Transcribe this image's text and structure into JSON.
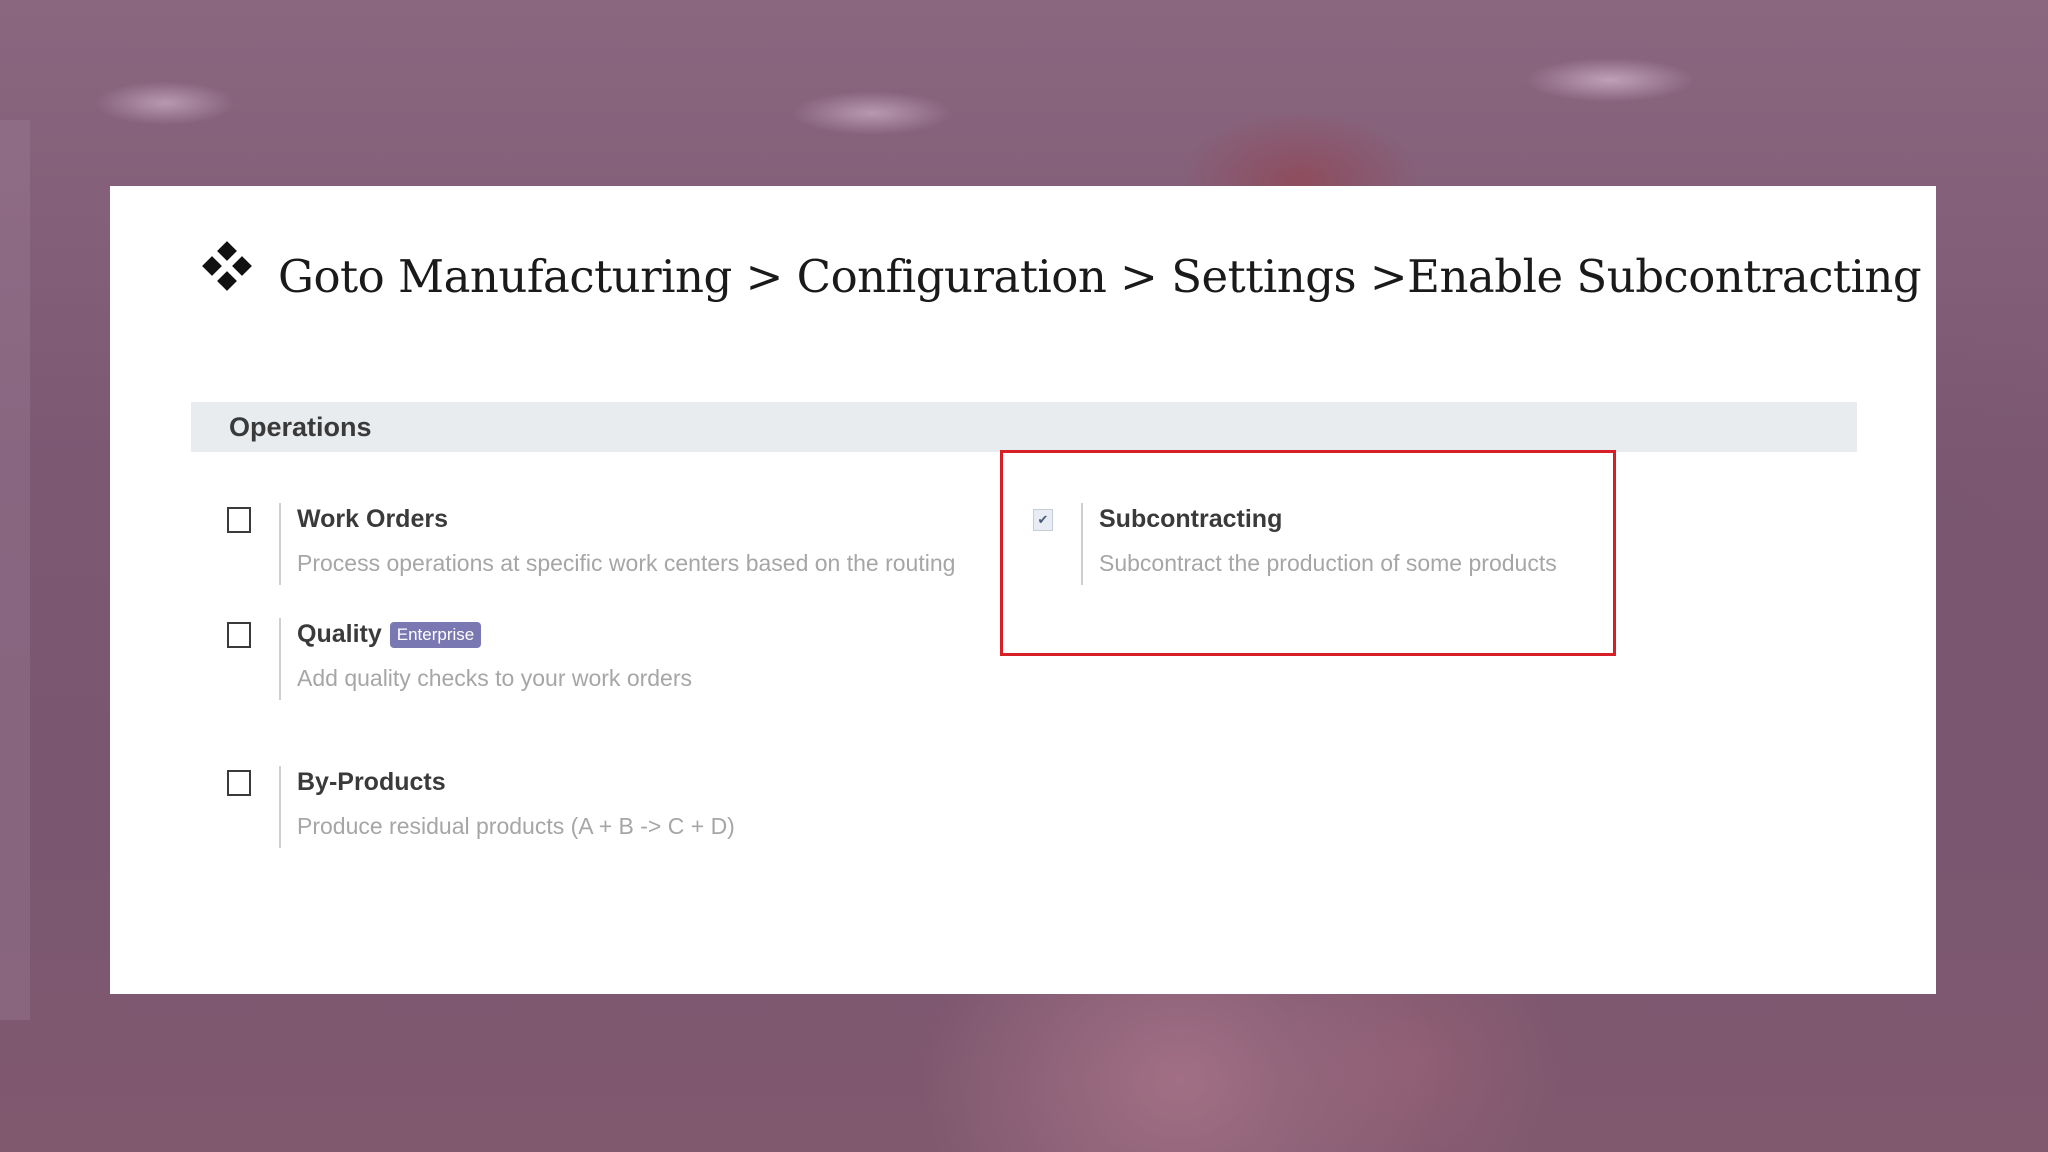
{
  "heading": {
    "bullet_icon": "four-diamond-bullet-icon",
    "text": "Goto Manufacturing > Configuration > Settings >Enable Subcontracting"
  },
  "section": {
    "title": "Operations"
  },
  "settings": [
    {
      "label": "Work Orders",
      "description": "Process operations at specific work centers based on the routing",
      "checked": false
    },
    {
      "label": "Quality",
      "badge": "Enterprise",
      "description": "Add quality checks to your work orders",
      "checked": false
    },
    {
      "label": "By-Products",
      "description": "Produce residual products (A + B -> C + D)",
      "checked": false
    },
    {
      "label": "Subcontracting",
      "description": "Subcontract the production of some products",
      "checked": true,
      "check_glyph": "✔"
    }
  ],
  "colors": {
    "highlight_border": "#d61f26",
    "badge_background": "#7a78b3",
    "section_header_background": "#e9ecef",
    "background": "#7f5a75"
  }
}
